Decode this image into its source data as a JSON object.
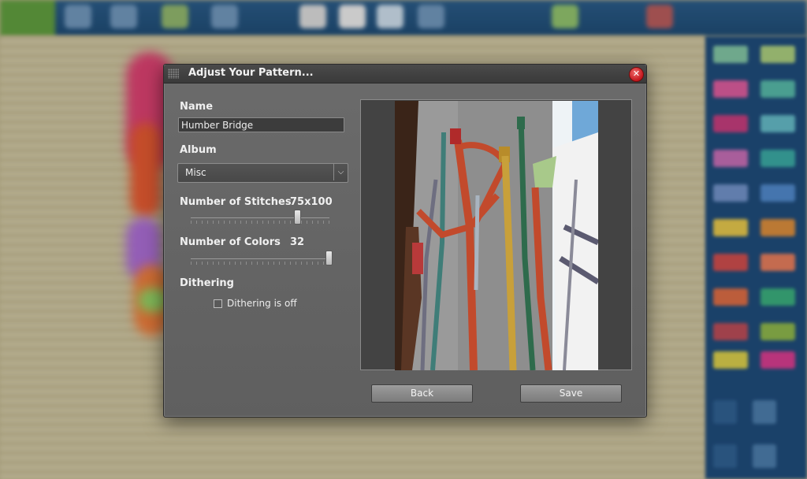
{
  "dialog": {
    "title": "Adjust Your Pattern...",
    "close_icon": "close-icon"
  },
  "name": {
    "label": "Name",
    "value": "Humber Bridge"
  },
  "album": {
    "label": "Album",
    "selected": "Misc",
    "dropdown_icon": "chevron-down-icon"
  },
  "stitches": {
    "label": "Number of Stitches",
    "value": "75x100",
    "slider_level": 0.77
  },
  "colors": {
    "label": "Number of Colors",
    "value": "32",
    "slider_level": 1.0
  },
  "dithering": {
    "label": "Dithering",
    "checkbox_label": "Dithering is off",
    "checked": false
  },
  "buttons": {
    "back": "Back",
    "save": "Save"
  },
  "theme": {
    "dialog_bg": "#656565",
    "titlebar_bg": "#404040",
    "close_red": "#c4161c"
  }
}
